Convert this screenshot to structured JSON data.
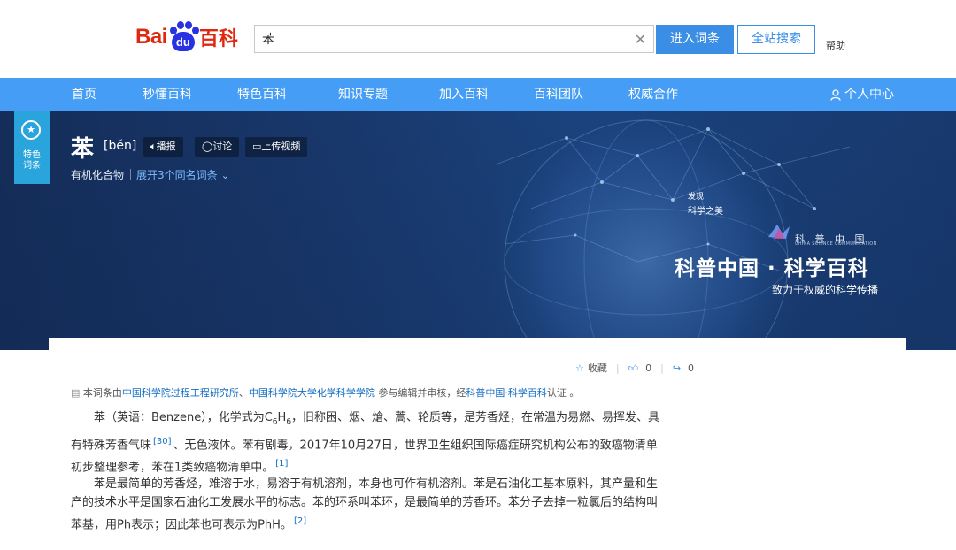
{
  "header": {
    "logo_bai": "Bai",
    "logo_du": "du",
    "logo_baike": "百科",
    "search_value": "苯",
    "enter_button": "进入词条",
    "site_search_button": "全站搜索",
    "help_link": "帮助"
  },
  "nav": {
    "items": [
      "首页",
      "秒懂百科",
      "特色百科",
      "知识专题",
      "加入百科",
      "百科团队",
      "权威合作"
    ],
    "user_center": "个人中心"
  },
  "banner": {
    "ribbon_label_1": "特色",
    "ribbon_label_2": "词条",
    "word": "苯",
    "pinyin": "[běn]",
    "pills": [
      "播报",
      "讨论",
      "上传视频"
    ],
    "category": "有机化合物",
    "expand_link": "展开3个同名词条",
    "discover_1": "发现",
    "discover_2": "科学之美",
    "kp_logo": "科 普 中 国",
    "kp_logo_en": "CHINA SCIENCE COMMUNICATION",
    "title": "科普中国 · 科学百科",
    "slogan": "致力于权威的科学传播"
  },
  "actions": {
    "collect": "收藏",
    "collect_count": "0",
    "like_count": "0",
    "share_count": "0"
  },
  "audit": {
    "prefix": "本词条由",
    "org1": "中国科学院过程工程研究所",
    "comma": "、",
    "org2": "中国科学院大学化学科学学院",
    "middle": " 参与编辑并审核，经",
    "cert": "科普中国·科学百科",
    "suffix": "认证 。"
  },
  "paragraphs": {
    "p1_a": "苯（英语：Benzene），化学式为C",
    "p1_sub1": "6",
    "p1_b": "H",
    "p1_sub2": "6",
    "p1_c": "，旧称困、烟、熗、蒿、轮质等，是芳香烃，在常温为易燃、易挥发、具有特殊芳香气味",
    "p1_ref1": "[30]",
    "p1_d": "、无色液体。苯有剧毒，2017年10月27日，世界卫生组织国际癌症研究机构公布的致癌物清单初步整理参考，苯在1类致癌物清单中。",
    "p1_ref2": "[1]",
    "p2": "苯是最简单的芳香烃，难溶于水，易溶于有机溶剂，本身也可作有机溶剂。苯是石油化工基本原料，其产量和生产的技术水平是国家石油化工发展水平的标志。苯的环系叫苯环，是最简单的芳香环。苯分子去掉一粒氯后的结构叫苯基，用Ph表示；因此苯也可表示为PhH。",
    "p2_ref": "[2]"
  },
  "colors": {
    "brand_red": "#de2910",
    "brand_blue": "#2932e1",
    "nav_blue": "#459df5",
    "button_blue": "#3a8ee6",
    "link_blue": "#136ec2"
  }
}
